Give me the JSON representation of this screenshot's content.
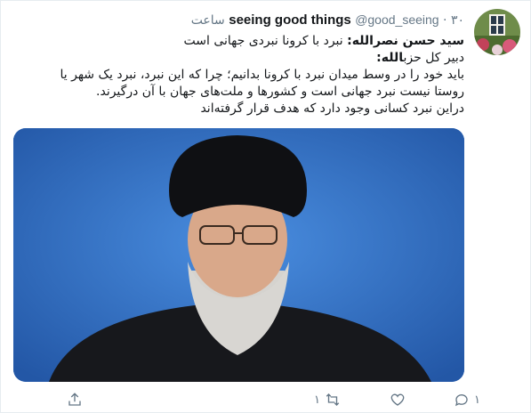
{
  "tweet": {
    "display_name": "seeing good things",
    "handle": "@good_seeing",
    "separator": "·",
    "time": "۳۰ ساعت",
    "line1_bold": "سید حسن نصرالله:",
    "line1_rest": " نبرد با کرونا نبردی جهانی است",
    "line2_rest": "دبیر کل حزب",
    "line2_bold": "الله:",
    "line3": "باید خود را در وسط میدان نبرد با کرونا بدانیم؛ چرا که این نبرد، نبرد یک شهر یا",
    "line4": "روستا نیست نبرد جهانی است و کشورها و ملت‌های جهان با آن درگیرند.",
    "line5": "دراین نبرد کسانی وجود دارد که هدف قرار گرفته‌اند"
  },
  "actions": {
    "reply_count": "۱",
    "retweet_count": "۱",
    "like_count": ""
  },
  "colors": {
    "text": "#14171a",
    "muted": "#657786",
    "image_bg": "#2f6fc2"
  }
}
